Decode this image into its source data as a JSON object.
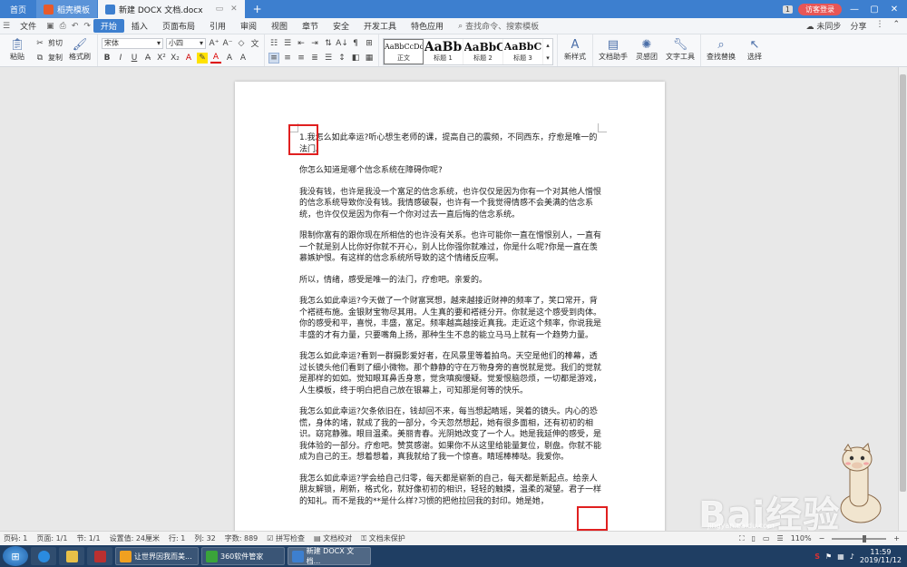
{
  "tabs": {
    "home": "首页",
    "items": [
      {
        "label": "稻壳模板",
        "color": "#e85a2a",
        "active": false
      },
      {
        "label": "新建 DOCX 文档.docx",
        "color": "#3d7fcf",
        "active": true
      }
    ],
    "add": "+"
  },
  "titlebar": {
    "count": "1",
    "login": "访客登录"
  },
  "menu": {
    "file": "文件",
    "start": "开始",
    "items": [
      "插入",
      "页面布局",
      "引用",
      "审阅",
      "视图",
      "章节",
      "安全",
      "开发工具",
      "特色应用"
    ],
    "search": "查找命令、搜索模板",
    "sync": "未同步",
    "share": "分享"
  },
  "ribbon": {
    "paste": "粘贴",
    "cut": "剪切",
    "copy": "复制",
    "format_brush": "格式刷",
    "font": "宋体",
    "size": "小四",
    "styles": [
      {
        "preview": "AaBbCcDd",
        "label": "正文"
      },
      {
        "preview": "AaBb",
        "label": "标题 1"
      },
      {
        "preview": "AaBbC",
        "label": "标题 2"
      },
      {
        "preview": "AaBbC",
        "label": "标题 3"
      }
    ],
    "new_style": "新样式",
    "doc_helper": "文档助手",
    "inspiration": "灵感团",
    "text_tools": "文字工具",
    "find_replace": "查找替换",
    "select": "选择"
  },
  "document": {
    "paragraphs": [
      "1.我怎么如此幸运?听心想生老师的课，提高自己的震频，不同西东，疗愈是唯一的法门。",
      "你怎么知道是哪个信念系统在障碍你呢?",
      "我没有钱，也许是我没一个富足的信念系统，也许仅仅是因为你有一个对其他人憎恨的信念系统导致你没有钱。我情感破裂，也许有一个我觉得情感不会美满的信念系统，也许仅仅是因为你有一个你对过去一直后悔的信念系统。",
      "限制你富有的跟你现在所相信的也许没有关系。也许可能你一直在憎恨别人，一直有一个就是别人比你好你就不开心，别人比你强你就难过，你是什么呢?你是一直在羡慕嫉妒恨。有这样的信念系统所导致的这个情绪反应啊。",
      "所以，情绪，感受是唯一的法门，疗愈吧。亲爱的。",
      "我怎么如此幸运?今天做了一个财富冥想，越来越接近财神的频率了，笑口常开，背个褡裢布施。金银财宝物尽其用。人生真的要和褡裢分开。你就是这个感受到肉体。你的感受和平，喜悦，丰盛，富足。频率越高越接近真我。走近这个频率，你说我是丰盛的才有力量，只要嘴角上扬，那种生生不息的能立马马上就有一个趋势力量。",
      "我怎么如此幸运?看到一群摄影爱好者，在风景里等着拍鸟。天空是他们的棒幕，透过长镜头他们看到了细小微物。那个静静的守在万物身旁的喜悦就是觉。我们的觉就是那样的如如。觉知眼耳鼻舌身意，觉贪嗔痴慢疑。觉爱恨脑怨烦，一切都是游戏，人生模板，终于明白把自己放在银幕上，可知那是何等的快乐。",
      "我怎么如此幸运?欠条依旧在，钱却回不来，每当想起睛瑶，哭着的镜头。内心的恐慌，身体的堵，就成了我的一部分，今天忽然想起，她有很多面相，还有初初的相识。窈窕静雅。眼目温柔。美丽青春。光阴她改变了一个人。她是我延伸的感受，是我体验的一部分。疗愈吧。赞赏感谢。如果你不从这里给能量复位，剔盘。你就不能成为自己的王。想着想着，真我就给了我一个惊喜。睛瑶棒棒哒。我爱你。",
      "我怎么如此幸运?学会给自己归零，每天都是崭新的自己，每天都是新起点。给亲人朋友解锁，刷新，格式化，就好像初初的相识，轻轻的触摸，温柔的凝望。君子一样的知礼。而不是我的**是什么样?习惯的把他拉回我的封印。她是她，"
    ]
  },
  "statusbar": {
    "page": "页码: 1",
    "pages": "页面: 1/1",
    "section": "节: 1/1",
    "setting": "设置值: 24厘米",
    "row": "行: 1",
    "col": "列: 32",
    "words": "字数: 889",
    "spell": "拼写检查",
    "proof": "文档校对",
    "protect": "文档未保护",
    "zoom": "110%"
  },
  "watermark": {
    "text": "Bai经验",
    "sub": "jingyan.baidu.com"
  },
  "taskbar": {
    "apps": [
      {
        "label": "让世界因我而美...",
        "color": "#f0a020"
      },
      {
        "label": "360软件管家",
        "color": "#3aa43a"
      },
      {
        "label": "新建 DOCX 文档...",
        "color": "#3d7fcf"
      }
    ],
    "time": "11:59",
    "date": "2019/11/12"
  }
}
